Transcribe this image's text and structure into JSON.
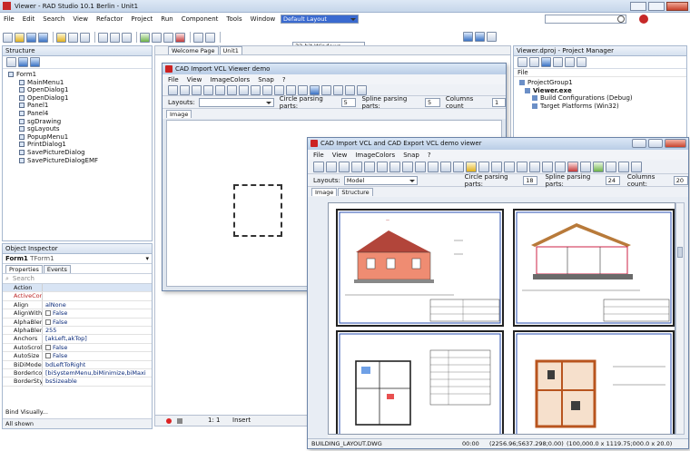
{
  "ide": {
    "title": "Viewer - RAD Studio 10.1 Berlin - Unit1",
    "menu": [
      "File",
      "Edit",
      "Search",
      "View",
      "Refactor",
      "Project",
      "Run",
      "Component",
      "Tools",
      "Window",
      "Help"
    ],
    "layout_combo": "Default Layout",
    "platform_combo": "32-bit Windows",
    "status_text": "All shown",
    "editor_pos": "1: 1",
    "editor_mode": "Insert"
  },
  "structure": {
    "title": "Structure",
    "items": [
      "Form1",
      "MainMenu1",
      "OpenDialog1",
      "OpenDialog1",
      "Panel1",
      "Panel4",
      "sgDrawing",
      "sgLayouts",
      "PopupMenu1",
      "PrintDialog1",
      "SavePictureDialog",
      "SavePictureDialogEMF"
    ]
  },
  "inspector": {
    "title": "Object Inspector",
    "selected": "Form1",
    "selected_type": "TForm1",
    "tabs": [
      "Properties",
      "Events"
    ],
    "search": "Search",
    "rows": [
      {
        "k": "Action",
        "v": ""
      },
      {
        "k": "ActiveControl",
        "v": ""
      },
      {
        "k": "Align",
        "v": "alNone"
      },
      {
        "k": "AlignWithMargins",
        "v": "False"
      },
      {
        "k": "AlphaBlend",
        "v": "False"
      },
      {
        "k": "AlphaBlendValue",
        "v": "255"
      },
      {
        "k": "Anchors",
        "v": "[akLeft,akTop]"
      },
      {
        "k": "AutoScroll",
        "v": "False"
      },
      {
        "k": "AutoSize",
        "v": "False"
      },
      {
        "k": "BiDiMode",
        "v": "bdLeftToRight"
      },
      {
        "k": "BorderIcons",
        "v": "[biSystemMenu,biMinimize,biMaxi"
      },
      {
        "k": "BorderStyle",
        "v": "bsSizeable"
      }
    ],
    "bind_visually": "Bind Visually..."
  },
  "doc_tabs": [
    "Welcome Page",
    "Unit1"
  ],
  "project_manager": {
    "title": "Viewer.dproj - Project Manager",
    "file_label": "File",
    "items": [
      "ProjectGroup1",
      "Viewer.exe",
      "Build Configurations (Debug)",
      "Target Platforms (Win32)"
    ]
  },
  "viewer1": {
    "title": "CAD Import VCL Viewer demo",
    "menu": [
      "File",
      "View",
      "ImageColors",
      "Snap",
      "?"
    ],
    "layouts_label": "Layouts:",
    "circle_label": "Circle parsing parts:",
    "circle_val": "5",
    "spline_label": "Spline parsing parts:",
    "spline_val": "5",
    "columns_label": "Columns count",
    "columns_val": "1",
    "tab": "Image"
  },
  "viewer2": {
    "title": "CAD Import VCL and CAD Export VCL demo viewer",
    "menu": [
      "File",
      "View",
      "ImageColors",
      "Snap",
      "?"
    ],
    "layouts_label": "Layouts:",
    "layout_value": "Model",
    "circle_label": "Circle parsing parts:",
    "circle_val": "18",
    "spline_label": "Spline parsing parts:",
    "spline_val": "24",
    "columns_label": "Columns count:",
    "columns_val": "20",
    "tabs": [
      "Image",
      "Structure"
    ],
    "status_file": "BUILDING_LAYOUT.DWG",
    "status_count": "00:00",
    "status_coords": "(2256.96;5637.298;0.00)",
    "status_size": "(100,000.0 x 1119.75;000.0 x 20.0)"
  }
}
